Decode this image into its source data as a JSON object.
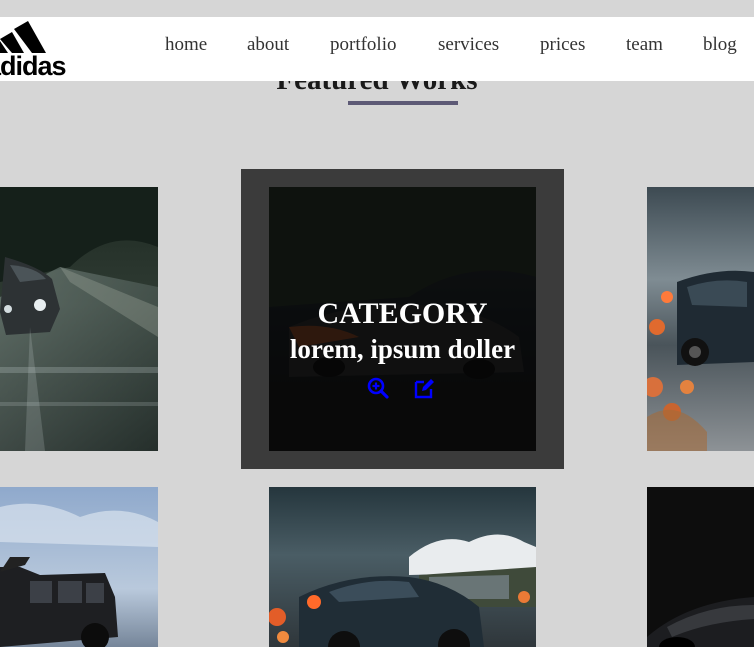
{
  "header": {
    "logo_text": "adidas",
    "nav": [
      "home",
      "about",
      "portfolio",
      "services",
      "prices",
      "team",
      "blog"
    ]
  },
  "section": {
    "title": "Featured Works"
  },
  "featured_overlay": {
    "category": "CATEGORY",
    "title": "lorem, ipsum doller",
    "icons": [
      "zoom-in-icon",
      "edit-icon"
    ]
  },
  "colors": {
    "page_bg": "#d6d6d6",
    "header_bg": "#ffffff",
    "nav_text": "#333333",
    "title_underline": "#5d5a76",
    "active_frame": "#3b3b3b",
    "overlay_icon": "#0000ff"
  }
}
